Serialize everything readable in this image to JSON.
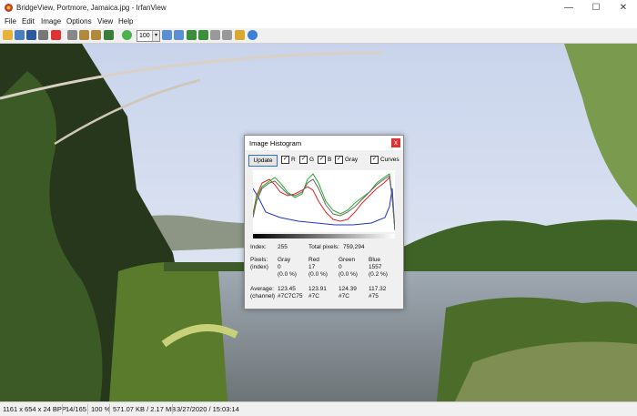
{
  "window": {
    "title": "BridgeView, Portmore, Jamaica.jpg - IrfanView",
    "min": "—",
    "max": "☐",
    "close": "✕"
  },
  "menu": [
    "File",
    "Edit",
    "Image",
    "Options",
    "View",
    "Help"
  ],
  "toolbar": {
    "zoom_value": "100",
    "zoom_arrow": "▾"
  },
  "status": {
    "dimensions": "1161 x 654 x 24 BPP",
    "index": "14/165",
    "zoom": "100 %",
    "size": "571.07 KB / 2.17 MB",
    "datetime": "3/27/2020 / 15:03:14"
  },
  "histogram_dialog": {
    "title": "Image Histogram",
    "close": "x",
    "update_button": "Update",
    "check": {
      "r": "R",
      "g": "G",
      "b": "B",
      "gray": "Gray",
      "curves": "Curves",
      "mark": "✓"
    },
    "index_label": "Index:",
    "index_value": "255",
    "total_label": "Total pixels:",
    "total_value": "759,294",
    "pixels_label": "Pixels:",
    "pixels_sub": "(index)",
    "average_label": "Average:",
    "average_sub": "(channel)",
    "columns": [
      {
        "name": "Gray",
        "pixels": "0",
        "pct": "(0.0 %)",
        "avg": "123.45",
        "hex": "#7C7C75"
      },
      {
        "name": "Red",
        "pixels": "17",
        "pct": "(0.0 %)",
        "avg": "123.91",
        "hex": "#7C"
      },
      {
        "name": "Green",
        "pixels": "0",
        "pct": "(0.0 %)",
        "avg": "124.39",
        "hex": "#7C"
      },
      {
        "name": "Blue",
        "pixels": "1557",
        "pct": "(0.2 %)",
        "avg": "117.32",
        "hex": "#75"
      }
    ]
  }
}
